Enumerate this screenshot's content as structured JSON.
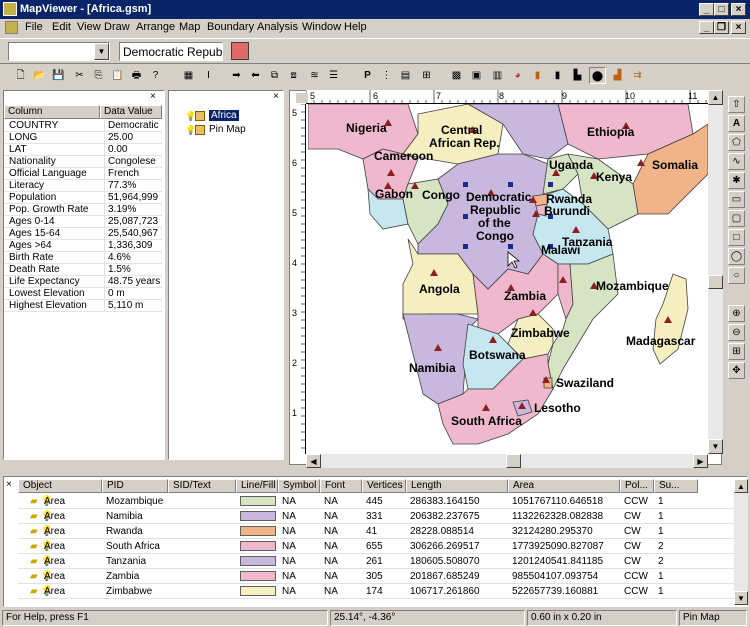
{
  "window": {
    "title": "MapViewer - [Africa.gsm]"
  },
  "menu": [
    "File",
    "Edit",
    "View",
    "Draw",
    "Arrange",
    "Map",
    "Boundary",
    "Analysis",
    "Window",
    "Help"
  ],
  "toolbar": {
    "combo_value": "",
    "field_value": "Democratic Repub"
  },
  "properties": {
    "col_header": "Column",
    "val_header": "Data Value",
    "rows": [
      {
        "k": "COUNTRY",
        "v": "Democratic R"
      },
      {
        "k": "LONG",
        "v": "25.00"
      },
      {
        "k": "LAT",
        "v": "0.00"
      },
      {
        "k": "Nationality",
        "v": "Congolese"
      },
      {
        "k": "Official Language",
        "v": "French"
      },
      {
        "k": "Literacy",
        "v": "77.3%"
      },
      {
        "k": "Population",
        "v": "51,964,999"
      },
      {
        "k": "Pop. Growth Rate",
        "v": "3.19%"
      },
      {
        "k": "Ages 0-14",
        "v": "25,087,723"
      },
      {
        "k": "Ages 15-64",
        "v": "25,540,967"
      },
      {
        "k": "Ages >64",
        "v": "1,336,309"
      },
      {
        "k": "Birth Rate",
        "v": "4.6%"
      },
      {
        "k": "Death Rate",
        "v": "1.5%"
      },
      {
        "k": "Life Expectancy",
        "v": "48.75 years"
      },
      {
        "k": "Lowest Elevation",
        "v": "0 m"
      },
      {
        "k": "Highest Elevation",
        "v": "5,110 m"
      }
    ]
  },
  "tree": {
    "items": [
      "Africa",
      "Pin Map"
    ]
  },
  "ruler": {
    "top": [
      "5",
      "6",
      "7",
      "8",
      "9",
      "10",
      "11"
    ],
    "left": [
      "5",
      "6",
      "5",
      "4",
      "3",
      "2",
      "1"
    ]
  },
  "map": {
    "labels": [
      "Nigeria",
      "Central",
      "African Rep.",
      "Ethiopia",
      "Cameroon",
      "Uganda",
      "Somalia",
      "Kenya",
      "Gabon",
      "Congo",
      "Democratic",
      "Republic",
      "of the",
      "Congo",
      "Rwanda",
      "Burundi",
      "Tanzania",
      "Angola",
      "Malawi",
      "Zambia",
      "Mozambique",
      "Madagascar",
      "Zimbabwe",
      "Botswana",
      "Namibia",
      "Swaziland",
      "Lesotho",
      "South Africa"
    ]
  },
  "grid": {
    "columns": [
      "Object",
      "PID",
      "SID/Text",
      "Line/Fill",
      "Symbol",
      "Font",
      "Vertices",
      "Length",
      "Area",
      "Pol...",
      "Su..."
    ],
    "rows": [
      {
        "obj": "Area",
        "pid": "Mozambique",
        "sid": "",
        "fill": "#d6e4c4",
        "sym": "NA",
        "font": "NA",
        "vert": "445",
        "len": "286383.164150",
        "area": "1051767110.646518",
        "pol": "CCW",
        "su": "1"
      },
      {
        "obj": "Area",
        "pid": "Namibia",
        "sid": "",
        "fill": "#c8b8de",
        "sym": "NA",
        "font": "NA",
        "vert": "331",
        "len": "206382.237675",
        "area": "1132262328.082838",
        "pol": "CW",
        "su": "1"
      },
      {
        "obj": "Area",
        "pid": "Rwanda",
        "sid": "",
        "fill": "#f0b488",
        "sym": "NA",
        "font": "NA",
        "vert": "41",
        "len": "28228.088514",
        "area": "32124280.295370",
        "pol": "CW",
        "su": "1"
      },
      {
        "obj": "Area",
        "pid": "South Africa",
        "sid": "",
        "fill": "#f0b8cc",
        "sym": "NA",
        "font": "NA",
        "vert": "655",
        "len": "306266.269517",
        "area": "1773925090.827087",
        "pol": "CW",
        "su": "2"
      },
      {
        "obj": "Area",
        "pid": "Tanzania",
        "sid": "",
        "fill": "#c8b8de",
        "sym": "NA",
        "font": "NA",
        "vert": "261",
        "len": "180605.508070",
        "area": "1201240541.841185",
        "pol": "CW",
        "su": "2"
      },
      {
        "obj": "Area",
        "pid": "Zambia",
        "sid": "",
        "fill": "#f0b8cc",
        "sym": "NA",
        "font": "NA",
        "vert": "305",
        "len": "201867.685249",
        "area": "985504107.093754",
        "pol": "CCW",
        "su": "1"
      },
      {
        "obj": "Area",
        "pid": "Zimbabwe",
        "sid": "",
        "fill": "#f4eec0",
        "sym": "NA",
        "font": "NA",
        "vert": "174",
        "len": "106717.261860",
        "area": "522657739.160881",
        "pol": "CCW",
        "su": "1"
      }
    ]
  },
  "status": {
    "help": "For Help, press F1",
    "coords": "25.14°, -4.36°",
    "size": "0.60 in x 0.20 in",
    "layer": "Pin Map"
  }
}
